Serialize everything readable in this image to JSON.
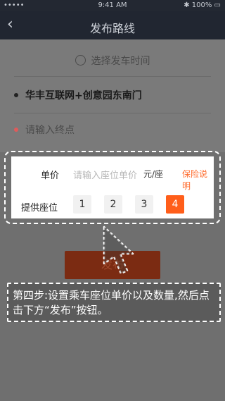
{
  "status_bar": {
    "left": "•••••",
    "time": "9:41 AM",
    "battery": "100%"
  },
  "navbar": {
    "back_icon": "chevron-left-icon",
    "title": "发布路线"
  },
  "form": {
    "time_placeholder": "选择发车时间",
    "start": "华丰互联网+创意园东南门",
    "end_placeholder": "请输入终点",
    "start_dot_color": "#222222",
    "end_dot_color": "#e05b5b"
  },
  "pricing": {
    "price_label": "单价",
    "price_placeholder": "请输入座位单价",
    "price_unit": "元/座",
    "insurance_link": "保险说明",
    "seat_label": "提供座位",
    "seats": [
      "1",
      "2",
      "3",
      "4"
    ],
    "selected_seat": "4",
    "accent": "#ff5e1a"
  },
  "publish_button": "发布",
  "tip": "第四步:设置乘车座位单价以及数量,然后点击下方“发布”按钮。"
}
